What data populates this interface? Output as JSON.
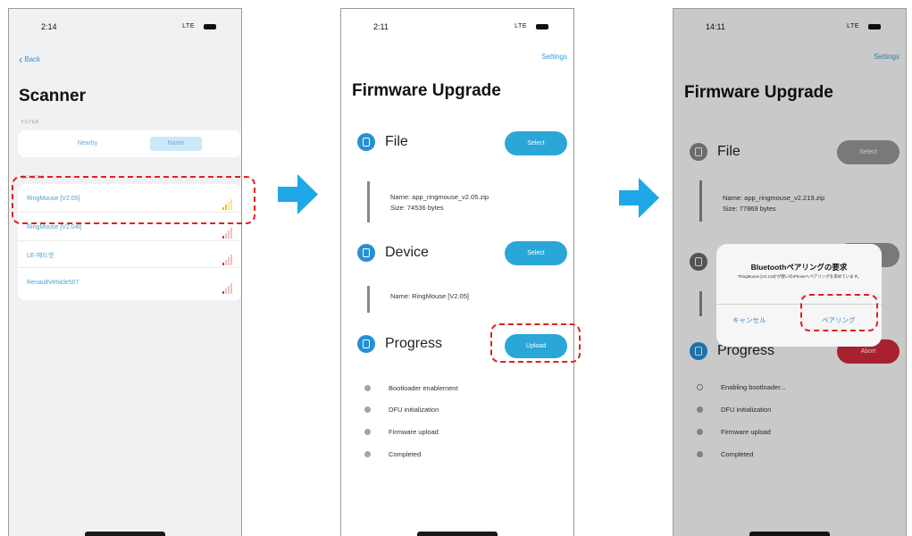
{
  "colors": {
    "accent": "#2aa7d8",
    "link": "#3a9fd8",
    "highlight": "#e0201d",
    "abort": "#d42a3c",
    "arrow": "#1ea8e8"
  },
  "scanner": {
    "time": "2:14",
    "network": "LTE",
    "back": "Back",
    "title": "Scanner",
    "filter_label": "FILTER",
    "filter_options": [
      "Nearby",
      "Name"
    ],
    "devices_label": "DEVICES",
    "devices": [
      {
        "name": "RingMouse [V2.05]",
        "signal_color": "#e8c21d"
      },
      {
        "name": "RingMouse [V2.04I]",
        "signal_color": "#d23a3a"
      },
      {
        "name": "LE-헤드셋",
        "signal_color": "#d23a3a"
      },
      {
        "name": "RenaultVehicle507",
        "signal_color": "#d23a3a"
      }
    ]
  },
  "upgrade1": {
    "time": "2:11",
    "network": "LTE",
    "settings": "Settings",
    "title": "Firmware Upgrade",
    "file_section": "File",
    "file_button": "Select",
    "file_name": "Name: app_ringmouse_v2.05.zip",
    "file_size": "Size: 74536 bytes",
    "device_section": "Device",
    "device_button": "Select",
    "device_name": "Name: RingMouse [V2.05]",
    "progress_section": "Progress",
    "progress_button": "Upload",
    "steps": [
      "Bootloader enablement",
      "DFU initialization",
      "Firmware upload",
      "Completed"
    ]
  },
  "upgrade2": {
    "time": "14:11",
    "network": "LTE",
    "settings": "Settings",
    "title": "Firmware Upgrade",
    "file_section": "File",
    "file_button": "Select",
    "file_name": "Name: app_ringmouse_v2.219.zip",
    "file_size": "Size: 77869 bytes",
    "progress_section": "Progress",
    "progress_button": "Abort",
    "steps": [
      "Enabling bootloader...",
      "DFU initialization",
      "Firmware upload",
      "Completed"
    ],
    "dialog": {
      "title": "Bluetoothペアリングの要求",
      "message": "\"RingMouse [V2.219]\"が使いのiPhoneへペアリングを求めています。",
      "cancel": "キャンセル",
      "confirm": "ペアリング"
    }
  }
}
